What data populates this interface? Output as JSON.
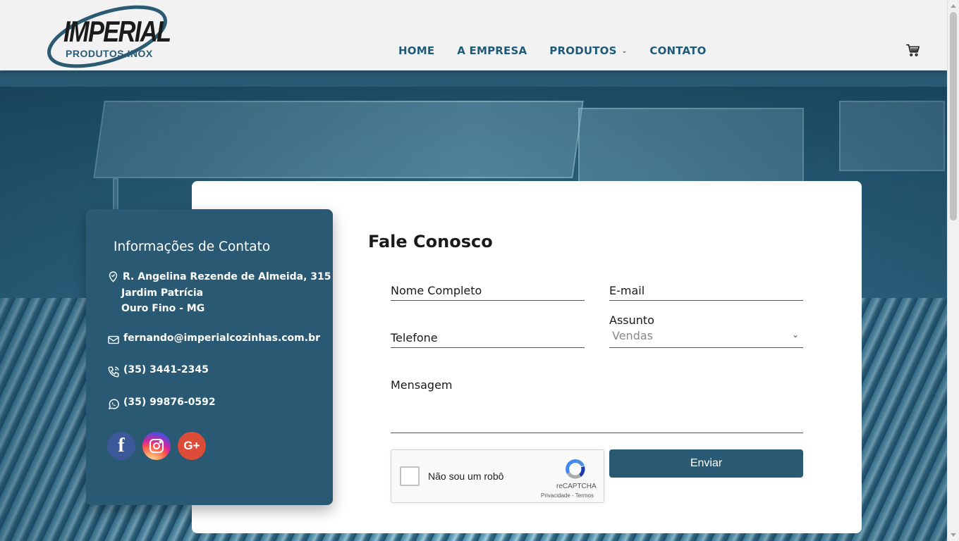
{
  "brand": {
    "logo_main": "IMPERIAL",
    "logo_sub": "PRODUTOS INOX"
  },
  "nav": {
    "items": [
      {
        "label": "HOME"
      },
      {
        "label": "A EMPRESA"
      },
      {
        "label": "PRODUTOS",
        "has_dropdown": true
      },
      {
        "label": "CONTATO"
      }
    ],
    "cart_icon": "cart-icon"
  },
  "contact_info": {
    "title": "Informações de Contato",
    "address_line1": "R. Angelina Rezende de Almeida, 315",
    "address_line2": "Jardim Patrícia",
    "address_line3": "Ouro Fino - MG",
    "email": "fernando@imperialcozinhas.com.br",
    "phone": "(35) 3441-2345",
    "whatsapp": "(35) 99876-0592",
    "social": [
      {
        "name": "facebook",
        "glyph": "f",
        "color": "#3b5998"
      },
      {
        "name": "instagram",
        "color": "#e1306c"
      },
      {
        "name": "google-plus",
        "glyph": "G+",
        "color": "#dd4b39"
      }
    ]
  },
  "form": {
    "title": "Fale Conosco",
    "name_label": "Nome Completo",
    "email_label": "E-mail",
    "phone_label": "Telefone",
    "subject_label": "Assunto",
    "subject_value": "Vendas",
    "message_label": "Mensagem",
    "recaptcha_label": "Não sou um robô",
    "recaptcha_brand": "reCAPTCHA",
    "recaptcha_links": "Privacidade - Termos",
    "submit_label": "Enviar"
  },
  "colors": {
    "primary": "#2a5a73",
    "nav_text": "#1f5a79",
    "header_bg": "#f2f2f2"
  }
}
